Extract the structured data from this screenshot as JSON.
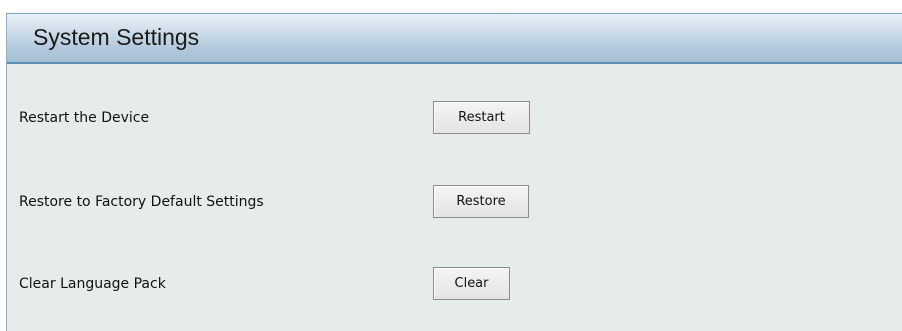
{
  "panel": {
    "title": "System Settings"
  },
  "rows": [
    {
      "label": "Restart the Device",
      "button_label": "Restart"
    },
    {
      "label": "Restore to Factory Default Settings",
      "button_label": "Restore"
    },
    {
      "label": "Clear Language Pack",
      "button_label": "Clear"
    }
  ]
}
